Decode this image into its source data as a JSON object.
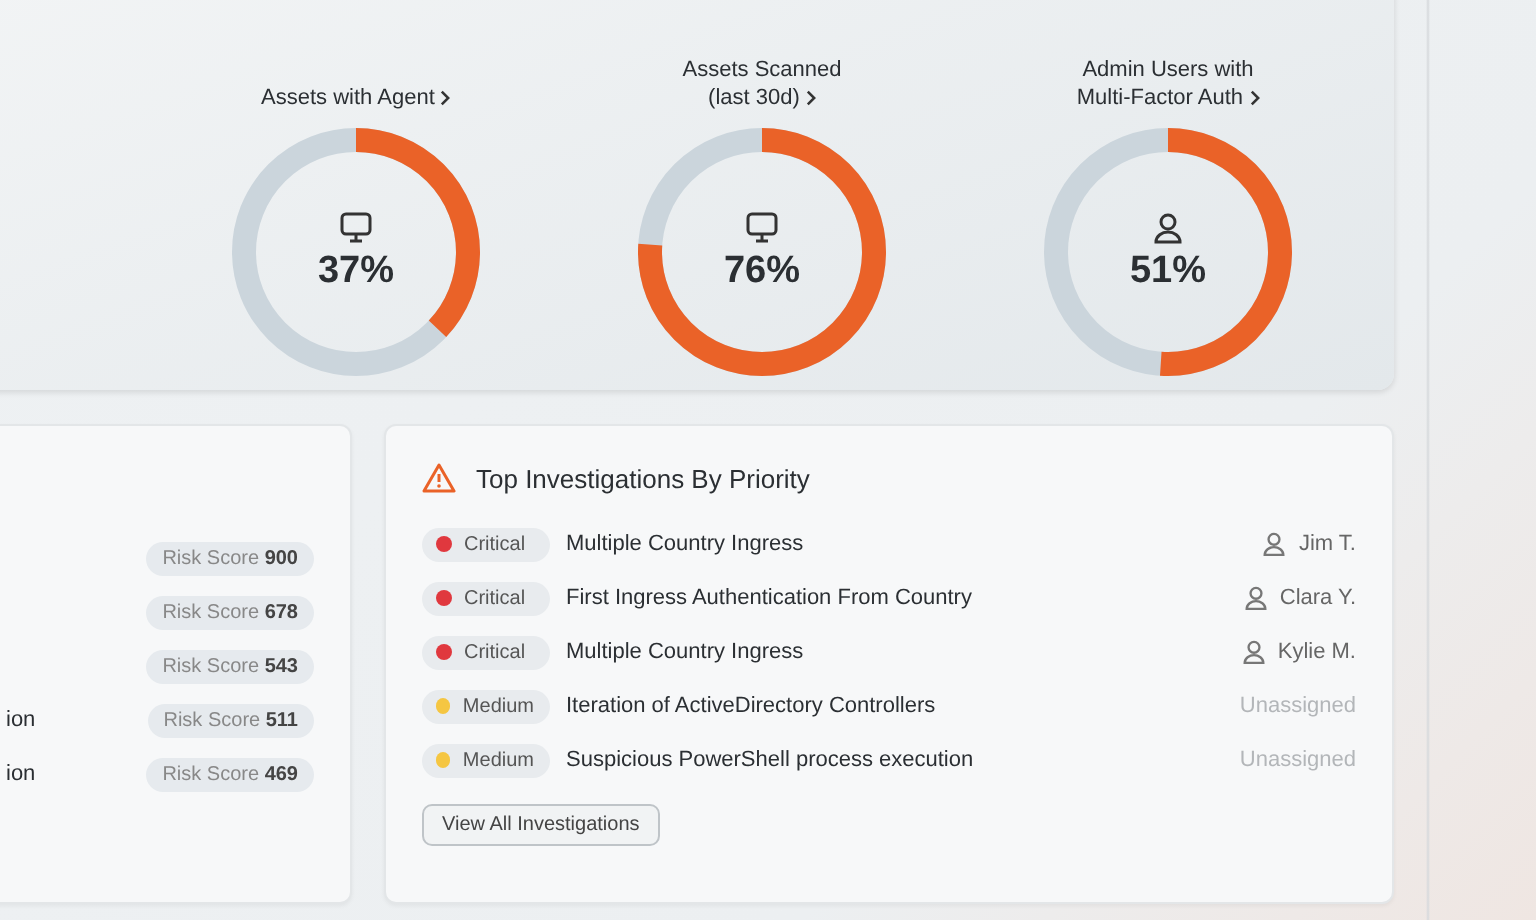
{
  "gauges": [
    {
      "title": [
        "Assets with Agent"
      ],
      "kind": "assets",
      "level": 0.37,
      "reading": "37%"
    },
    {
      "title": [
        "Assets Scanned",
        "(last 30d)"
      ],
      "kind": "assets",
      "level": 0.76,
      "reading": "76%"
    },
    {
      "title": [
        "Admin Users with",
        "Multi-Factor Auth"
      ],
      "kind": "users",
      "level": 0.51,
      "reading": "51%"
    }
  ],
  "risk_list": {
    "rows": [
      {
        "name": "",
        "label": "Risk Score",
        "score": "900"
      },
      {
        "name": "",
        "label": "Risk Score",
        "score": "678"
      },
      {
        "name": "",
        "label": "Risk Score",
        "score": "543"
      },
      {
        "name": "ion",
        "label": "Risk Score",
        "score": "511"
      },
      {
        "name": "ion",
        "label": "Risk Score",
        "score": "469"
      }
    ]
  },
  "investigations": {
    "title": "Top Investigations By Priority",
    "rows": [
      {
        "priority": "Critical",
        "color": "#e0383e",
        "name": "Multiple Country Ingress",
        "assignee": "Jim T.",
        "assigned": true
      },
      {
        "priority": "Critical",
        "color": "#e0383e",
        "name": "First Ingress Authentication From Country",
        "assignee": "Clara Y.",
        "assigned": true
      },
      {
        "priority": "Critical",
        "color": "#e0383e",
        "name": "Multiple Country Ingress",
        "assignee": "Kylie M.",
        "assigned": true
      },
      {
        "priority": "Medium",
        "color": "#f5c642",
        "name": "Iteration of ActiveDirectory Controllers",
        "assignee": "Unassigned",
        "assigned": false
      },
      {
        "priority": "Medium",
        "color": "#f5c642",
        "name": "Suspicious PowerShell process execution",
        "assignee": "Unassigned",
        "assigned": false
      }
    ],
    "button": "View  All Investigations"
  }
}
